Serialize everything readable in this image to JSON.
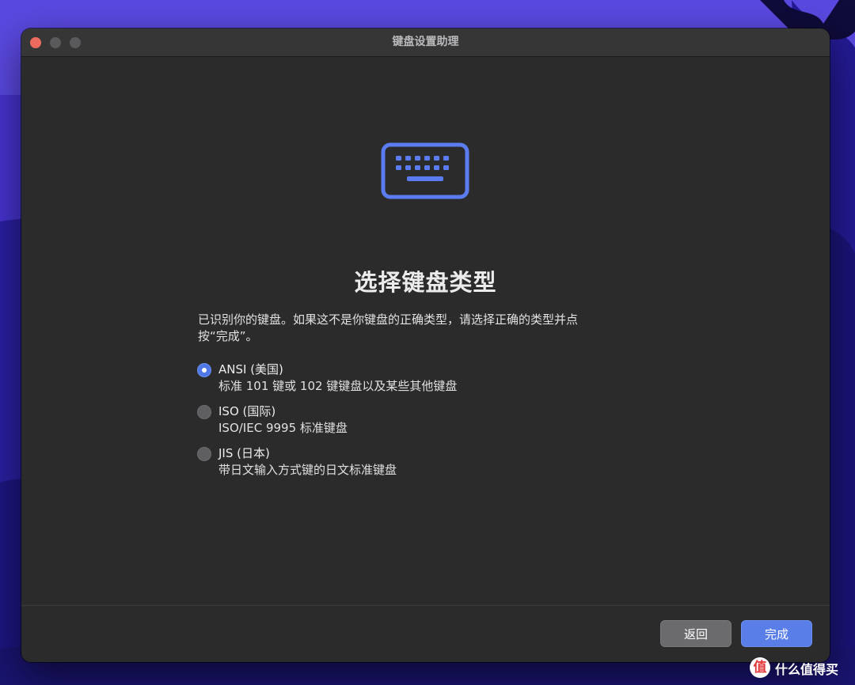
{
  "window": {
    "title": "键盘设置助理",
    "traffic_lights": [
      "close",
      "minimize",
      "zoom"
    ]
  },
  "main": {
    "icon": "keyboard-icon",
    "heading": "选择键盘类型",
    "description_line1": "已识别你的键盘。如果这不是你键盘的正确类型，请选择正确的类型并点",
    "description_line2": "按“完成”。",
    "options": [
      {
        "title": "ANSI (美国)",
        "subtitle": "标准 101 键或 102 键键盘以及某些其他键盘",
        "selected": true
      },
      {
        "title": "ISO (国际)",
        "subtitle": "ISO/IEC 9995 标准键盘",
        "selected": false
      },
      {
        "title": "JIS (日本)",
        "subtitle": "带日文输入方式键的日文标准键盘",
        "selected": false
      }
    ]
  },
  "footer": {
    "back_label": "返回",
    "done_label": "完成"
  },
  "watermark": {
    "logo": "值",
    "text": "什么值得买"
  },
  "colors": {
    "accent": "#5a7ee8",
    "window_bg": "#2b2b2c",
    "wallpaper": "#3f2fc6"
  }
}
